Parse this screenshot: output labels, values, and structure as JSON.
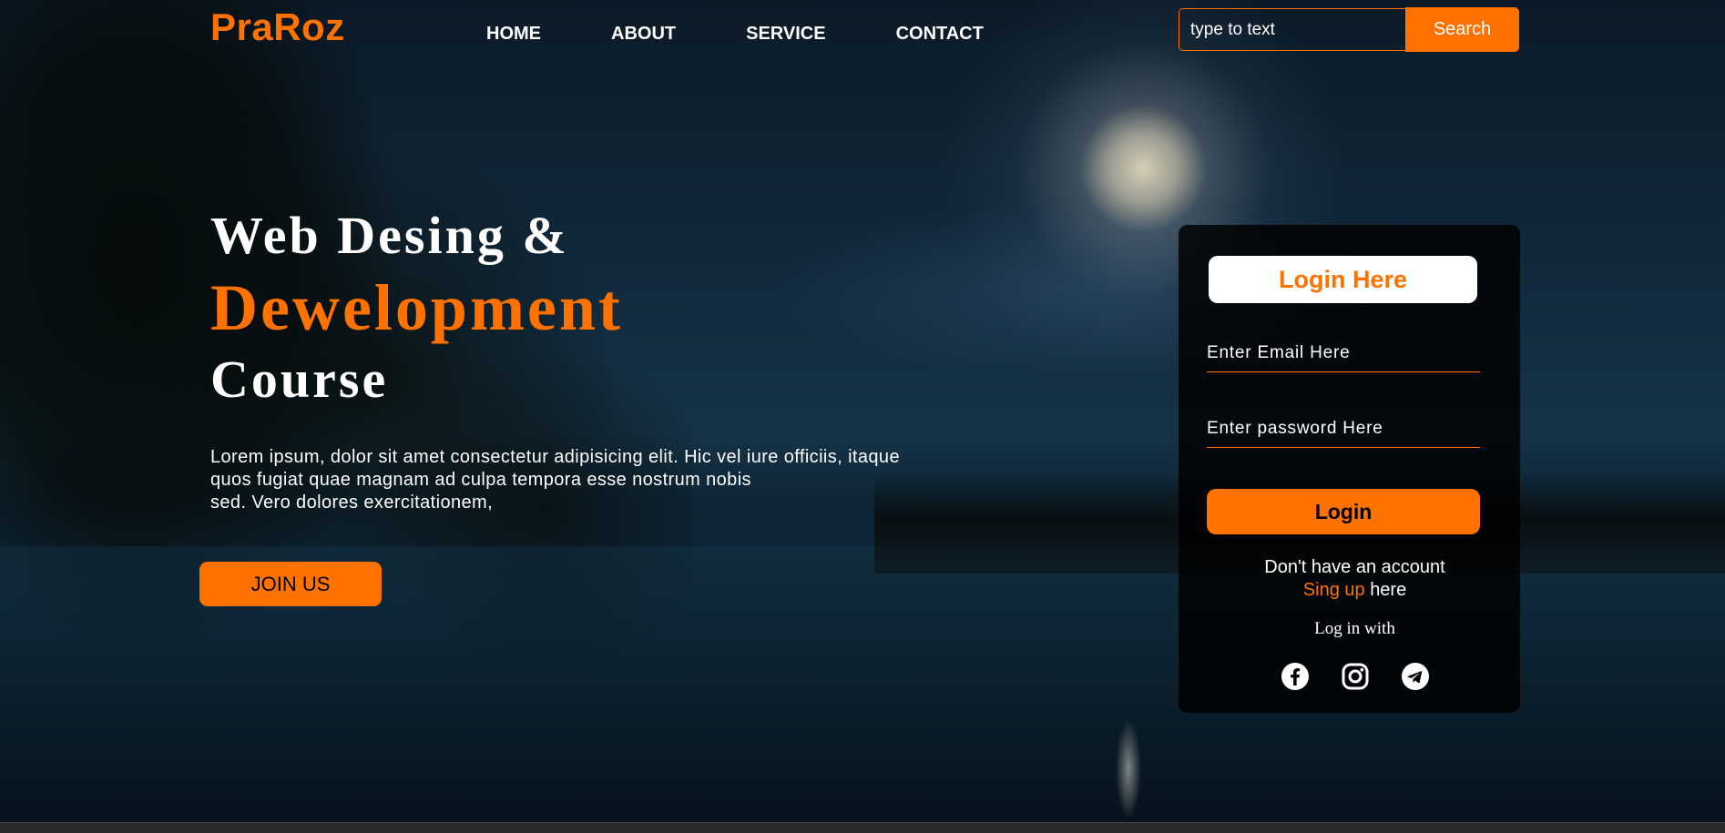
{
  "brand": {
    "logo": "PraRoz",
    "accent_color": "#ff7200"
  },
  "nav": {
    "items": [
      {
        "label": "HOME"
      },
      {
        "label": "ABOUT"
      },
      {
        "label": "SERVICE"
      },
      {
        "label": "CONTACT"
      }
    ]
  },
  "search": {
    "placeholder": "type to text",
    "button_label": "Search"
  },
  "hero": {
    "title_line1": "Web Desing &",
    "title_line2": "Dewelopment",
    "title_line3": "Course",
    "paragraph_line1": "Lorem ipsum, dolor sit amet consectetur adipisicing elit. Hic vel iure officiis, itaque",
    "paragraph_line2": "quos fugiat quae magnam ad culpa tempora esse nostrum nobis",
    "paragraph_line3": "sed. Vero dolores exercitationem,",
    "join_button": "JOIN US"
  },
  "login": {
    "title": "Login Here",
    "email_placeholder": "Enter Email Here",
    "password_placeholder": "Enter password Here",
    "button_label": "Login",
    "no_account_text": "Don't have an account",
    "signup_link": "Sing up",
    "signup_suffix": "here",
    "login_with": "Log in with",
    "socials": [
      {
        "icon": "facebook-icon"
      },
      {
        "icon": "instagram-icon"
      },
      {
        "icon": "telegram-icon"
      }
    ]
  }
}
